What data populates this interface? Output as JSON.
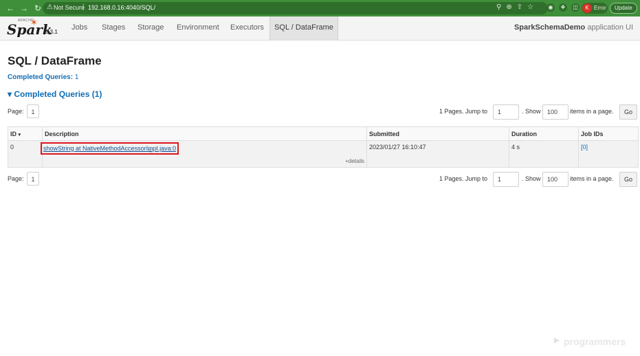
{
  "browser": {
    "not_secure": "Not Secure",
    "url": "192.168.0.16:4040/SQL/",
    "error_label": "Error",
    "error_avatar": "K",
    "update_label": "Update"
  },
  "navbar": {
    "logo_apache": "APACHE",
    "logo_word": "Spark",
    "version": "3.3.1",
    "tabs": [
      "Jobs",
      "Stages",
      "Storage",
      "Environment",
      "Executors",
      "SQL / DataFrame"
    ],
    "active_tab": "SQL / DataFrame",
    "app_name": "SparkSchemaDemo",
    "app_suffix": "application UI"
  },
  "page": {
    "title": "SQL / DataFrame",
    "summary_label": "Completed Queries:",
    "summary_value": "1",
    "section_title": "Completed Queries (1)"
  },
  "pager": {
    "page_label": "Page:",
    "current_page": "1",
    "pages_text": "1 Pages. Jump to",
    "jump_value": "1",
    "show_text": ". Show",
    "show_value": "100",
    "items_text": "items in a page.",
    "go_label": "Go"
  },
  "table": {
    "headers": [
      "ID",
      "Description",
      "Submitted",
      "Duration",
      "Job IDs"
    ],
    "rows": [
      {
        "id": "0",
        "description": "showString at NativeMethodAccessorImpl.java:0",
        "details": "+details",
        "submitted": "2023/01/27 16:10:47",
        "duration": "4 s",
        "job_ids": "[0]"
      }
    ]
  },
  "watermark": "programmers",
  "colors": {
    "browser_green": "#3f8f3a",
    "link_blue": "#0f6eb6",
    "highlight_red": "#e0141e",
    "spark_orange": "#e25a1c"
  }
}
